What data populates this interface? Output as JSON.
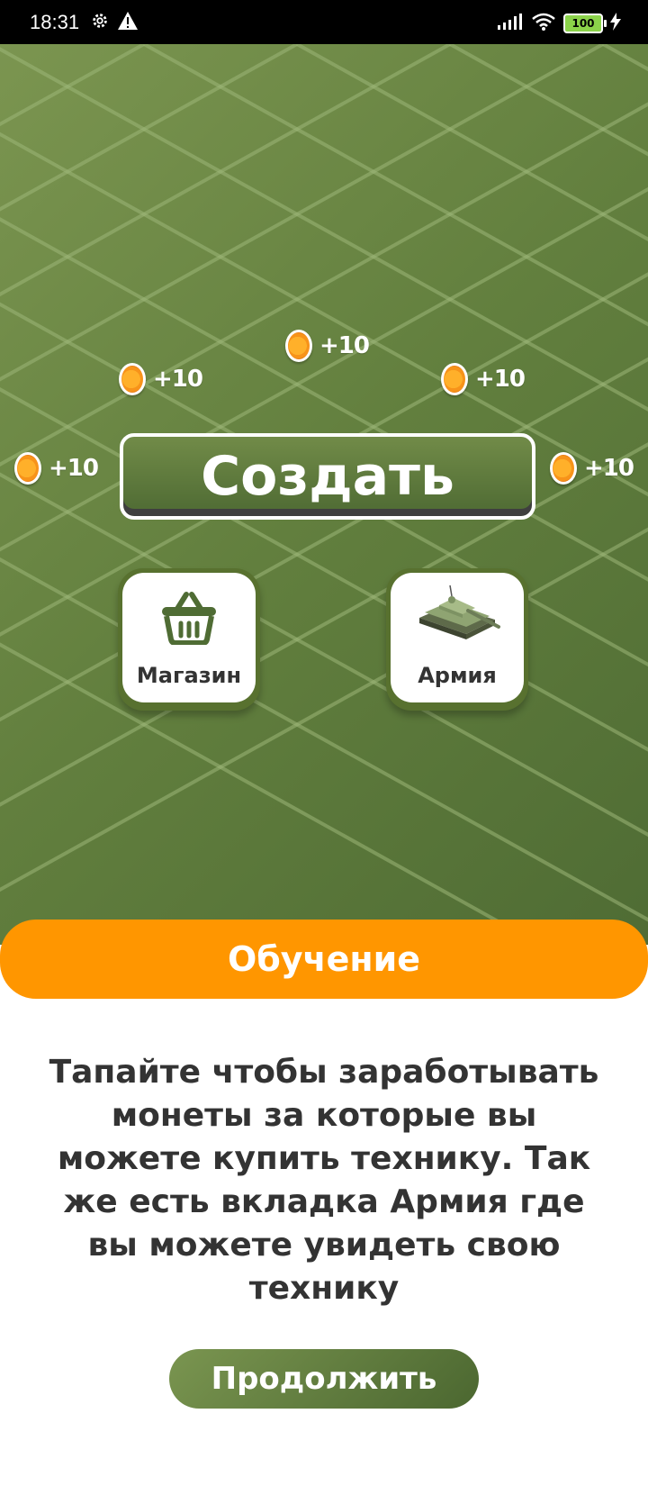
{
  "status_bar": {
    "time": "18:31",
    "battery": "100",
    "icons": [
      "gear-icon",
      "warning-icon",
      "signal-icon",
      "wifi-icon",
      "battery-icon",
      "charging-icon"
    ]
  },
  "coins": [
    {
      "label": "+10"
    },
    {
      "label": "+10"
    },
    {
      "label": "+10"
    },
    {
      "label": "+10"
    },
    {
      "label": "+10"
    }
  ],
  "create_button": {
    "label": "Создать"
  },
  "shop": {
    "label": "Магазин",
    "icon": "basket-icon"
  },
  "army": {
    "label": "Армия",
    "icon": "tank-icon"
  },
  "tutorial": {
    "title": "Обучение",
    "text": "Тапайте чтобы заработывать монеты за которые вы можете купить технику. Так же есть вкладка Армия где вы можете увидеть свою технику",
    "continue_label": "Продолжить"
  },
  "colors": {
    "accent": "#ff9600",
    "green_dark": "#4e6a33",
    "green_light": "#7b9550",
    "coin": "#f7931a"
  }
}
